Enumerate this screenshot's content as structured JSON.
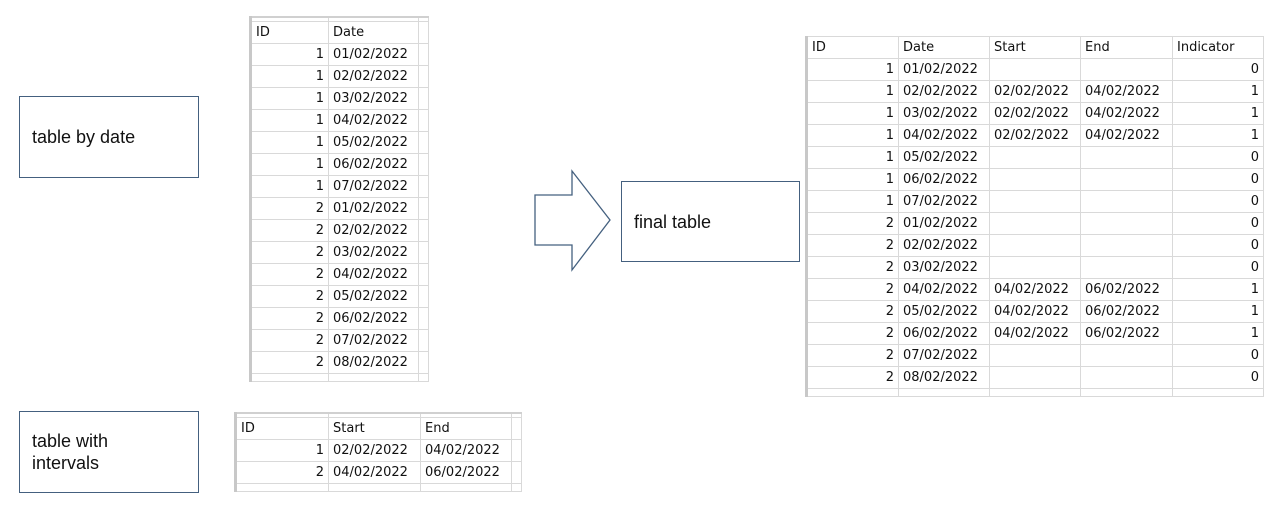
{
  "labels": {
    "table_by_date": "table by date",
    "table_with_intervals": [
      "table with",
      "intervals"
    ],
    "final_table": "final table"
  },
  "table_by_date": {
    "headers": [
      "ID",
      "Date"
    ],
    "rows": [
      [
        "1",
        "01/02/2022"
      ],
      [
        "1",
        "02/02/2022"
      ],
      [
        "1",
        "03/02/2022"
      ],
      [
        "1",
        "04/02/2022"
      ],
      [
        "1",
        "05/02/2022"
      ],
      [
        "1",
        "06/02/2022"
      ],
      [
        "1",
        "07/02/2022"
      ],
      [
        "2",
        "01/02/2022"
      ],
      [
        "2",
        "02/02/2022"
      ],
      [
        "2",
        "03/02/2022"
      ],
      [
        "2",
        "04/02/2022"
      ],
      [
        "2",
        "05/02/2022"
      ],
      [
        "2",
        "06/02/2022"
      ],
      [
        "2",
        "07/02/2022"
      ],
      [
        "2",
        "08/02/2022"
      ]
    ]
  },
  "table_with_intervals": {
    "headers": [
      "ID",
      "Start",
      "End"
    ],
    "rows": [
      [
        "1",
        "02/02/2022",
        "04/02/2022"
      ],
      [
        "2",
        "04/02/2022",
        "06/02/2022"
      ]
    ]
  },
  "final_table": {
    "headers": [
      "ID",
      "Date",
      "Start",
      "End",
      "Indicator"
    ],
    "rows": [
      [
        "1",
        "01/02/2022",
        "",
        "",
        "0"
      ],
      [
        "1",
        "02/02/2022",
        "02/02/2022",
        "04/02/2022",
        "1"
      ],
      [
        "1",
        "03/02/2022",
        "02/02/2022",
        "04/02/2022",
        "1"
      ],
      [
        "1",
        "04/02/2022",
        "02/02/2022",
        "04/02/2022",
        "1"
      ],
      [
        "1",
        "05/02/2022",
        "",
        "",
        "0"
      ],
      [
        "1",
        "06/02/2022",
        "",
        "",
        "0"
      ],
      [
        "1",
        "07/02/2022",
        "",
        "",
        "0"
      ],
      [
        "2",
        "01/02/2022",
        "",
        "",
        "0"
      ],
      [
        "2",
        "02/02/2022",
        "",
        "",
        "0"
      ],
      [
        "2",
        "03/02/2022",
        "",
        "",
        "0"
      ],
      [
        "2",
        "04/02/2022",
        "04/02/2022",
        "06/02/2022",
        "1"
      ],
      [
        "2",
        "05/02/2022",
        "04/02/2022",
        "06/02/2022",
        "1"
      ],
      [
        "2",
        "06/02/2022",
        "04/02/2022",
        "06/02/2022",
        "1"
      ],
      [
        "2",
        "07/02/2022",
        "",
        "",
        "0"
      ],
      [
        "2",
        "08/02/2022",
        "",
        "",
        "0"
      ]
    ]
  },
  "colors": {
    "box_border": "#44607f",
    "grid_line": "#d9d9d9"
  }
}
